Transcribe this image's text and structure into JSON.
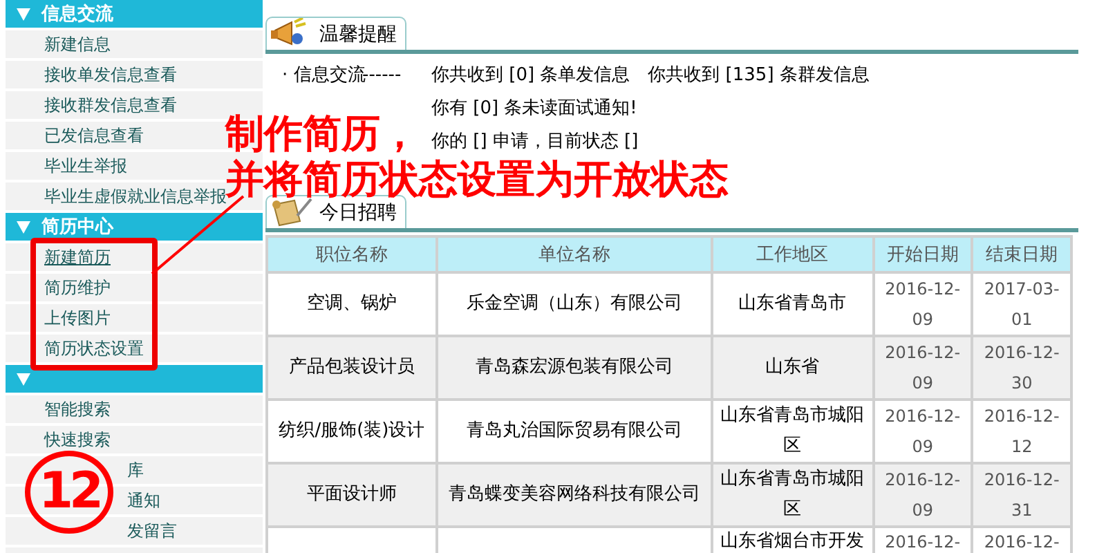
{
  "sidebar": {
    "sections": [
      {
        "title": "信息交流",
        "expanded": true,
        "items": [
          {
            "label": "新建信息",
            "selected": false,
            "kind": "plain"
          },
          {
            "label": "接收单发信息查看",
            "selected": false,
            "kind": "plain"
          },
          {
            "label": "接收群发信息查看",
            "selected": false,
            "kind": "plain"
          },
          {
            "label": "已发信息查看",
            "selected": false,
            "kind": "plain"
          },
          {
            "label": "毕业生举报",
            "selected": false,
            "kind": "plain"
          },
          {
            "label": "毕业生虚假就业信息举报",
            "selected": false,
            "kind": "plain"
          }
        ]
      },
      {
        "title": "简历中心",
        "expanded": true,
        "items": [
          {
            "label": "新建简历",
            "selected": true,
            "kind": "plain"
          },
          {
            "label": "简历维护",
            "selected": false,
            "kind": "plain"
          },
          {
            "label": "上传图片",
            "selected": false,
            "kind": "plain"
          },
          {
            "label": "简历状态设置",
            "selected": false,
            "kind": "plain"
          }
        ]
      },
      {
        "expanded": true,
        "items": [
          {
            "label": "智能搜索",
            "selected": false,
            "kind": "plain"
          },
          {
            "label": "快速搜索",
            "selected": false,
            "kind": "plain"
          },
          {
            "label": "库",
            "selected": false,
            "kind": "covered"
          },
          {
            "label": "通知",
            "selected": false,
            "kind": "covered"
          },
          {
            "label": "发留言",
            "selected": false,
            "kind": "covered"
          }
        ]
      }
    ]
  },
  "notice": {
    "tab": "温馨提醒",
    "lines": [
      {
        "label": "· 信息交流",
        "dashes": "------",
        "message": "你共收到 [0] 条单发信息　你共收到 [135] 条群发信息"
      },
      {
        "message": "你有 [0] 条未读面试通知!"
      },
      {
        "message": "你的 [] 申请，目前状态 []"
      }
    ]
  },
  "jobs": {
    "tab": "今日招聘",
    "table": {
      "columns": [
        "职位名称",
        "单位名称",
        "工作地区",
        "开始日期",
        "结束日期"
      ],
      "rows": [
        {
          "kind": "full",
          "cells": [
            "空调、锅炉",
            "乐金空调（山东）有限公司",
            "山东省青岛市",
            "2016-12-09",
            "2017-03-01"
          ]
        },
        {
          "kind": "full",
          "cells": [
            "产品包装设计员",
            "青岛森宏源包装有限公司",
            "山东省",
            "2016-12-09",
            "2016-12-30"
          ]
        },
        {
          "kind": "full",
          "cells": [
            "纺织/服饰(装)设计",
            "青岛丸治国际贸易有限公司",
            "山东省青岛市城阳区",
            "2016-12-09",
            "2016-12-12"
          ]
        },
        {
          "kind": "full",
          "cells": [
            "平面设计师",
            "青岛蝶变美容网络科技有限公司",
            "山东省青岛市城阳区",
            "2016-12-09",
            "2016-12-31"
          ]
        },
        {
          "kind": "cut",
          "cells": [
            null,
            null,
            "山东省烟台市开发",
            "2016-12-",
            "2016-12-"
          ]
        }
      ]
    }
  },
  "annotation": {
    "lines": [
      "制作简历，",
      "并将简历状态设置为开放状态"
    ],
    "step": "12"
  }
}
